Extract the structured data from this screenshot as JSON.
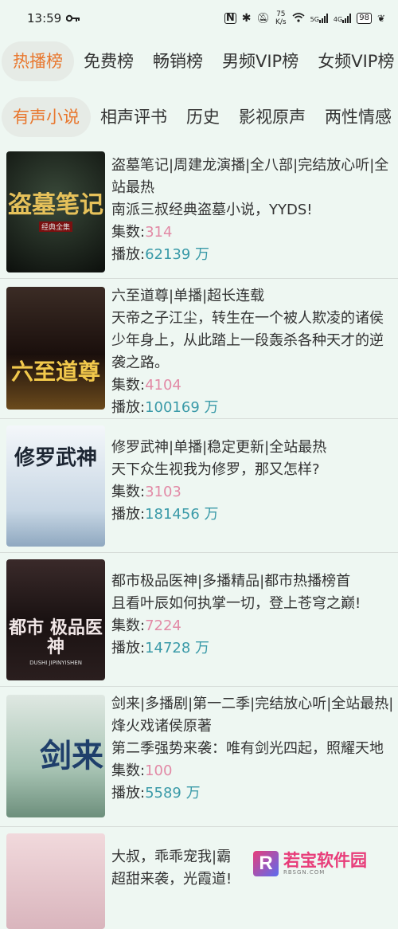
{
  "status_bar": {
    "time": "13:59",
    "net_speed_value": "75",
    "net_speed_unit": "K/s",
    "sig1": "5G",
    "sig2": "4G",
    "battery": "98"
  },
  "primary_tabs": [
    "热播榜",
    "免费榜",
    "畅销榜",
    "男频VIP榜",
    "女频VIP榜"
  ],
  "secondary_tabs": [
    "有声小说",
    "相声评书",
    "历史",
    "影视原声",
    "两性情感"
  ],
  "labels": {
    "episodes": "集数:",
    "plays": "播放:"
  },
  "books": [
    {
      "cover_text": "盗墓笔记",
      "cover_sub": "经典全集",
      "title": "盗墓笔记|周建龙演播|全八部|完结放心听|全站最热",
      "desc": "南派三叔经典盗墓小说，YYDS!",
      "episodes": "314",
      "plays": "62139 万"
    },
    {
      "cover_text": "六至道尊",
      "cover_sub": "",
      "title": "六至道尊|单播|超长连载",
      "desc": "天帝之子江尘，转生在一个被人欺凌的诸侯少年身上，从此踏上一段轰杀各种天才的逆袭之路。",
      "episodes": "4104",
      "plays": "100169 万"
    },
    {
      "cover_text": "修罗武神",
      "cover_sub": "",
      "title": "修罗武神|单播|稳定更新|全站最热",
      "desc": "天下众生视我为修罗，那又怎样?",
      "episodes": "3103",
      "plays": "181456 万"
    },
    {
      "cover_text": "都市 极品医神",
      "cover_sub": "DUSHI JIPINYISHEN",
      "title": "都市极品医神|多播精品|都市热播榜首",
      "desc": "且看叶辰如何执掌一切，登上苍穹之巅!",
      "episodes": "7224",
      "plays": "14728 万"
    },
    {
      "cover_text": "剑来",
      "cover_sub": "",
      "title": "剑来|多播剧|第一二季|完结放心听|全站最热|烽火戏诸侯原著",
      "desc": "第二季强势来袭：唯有剑光四起，照耀天地",
      "episodes": "100",
      "plays": "5589 万"
    },
    {
      "cover_text": "",
      "cover_sub": "",
      "title": "大叔，乖乖宠我|霸",
      "desc": "超甜来袭，光霞道!",
      "episodes": "",
      "plays": ""
    }
  ],
  "watermark": {
    "text": "若宝软件园",
    "sub": "RBSGN.COM"
  }
}
